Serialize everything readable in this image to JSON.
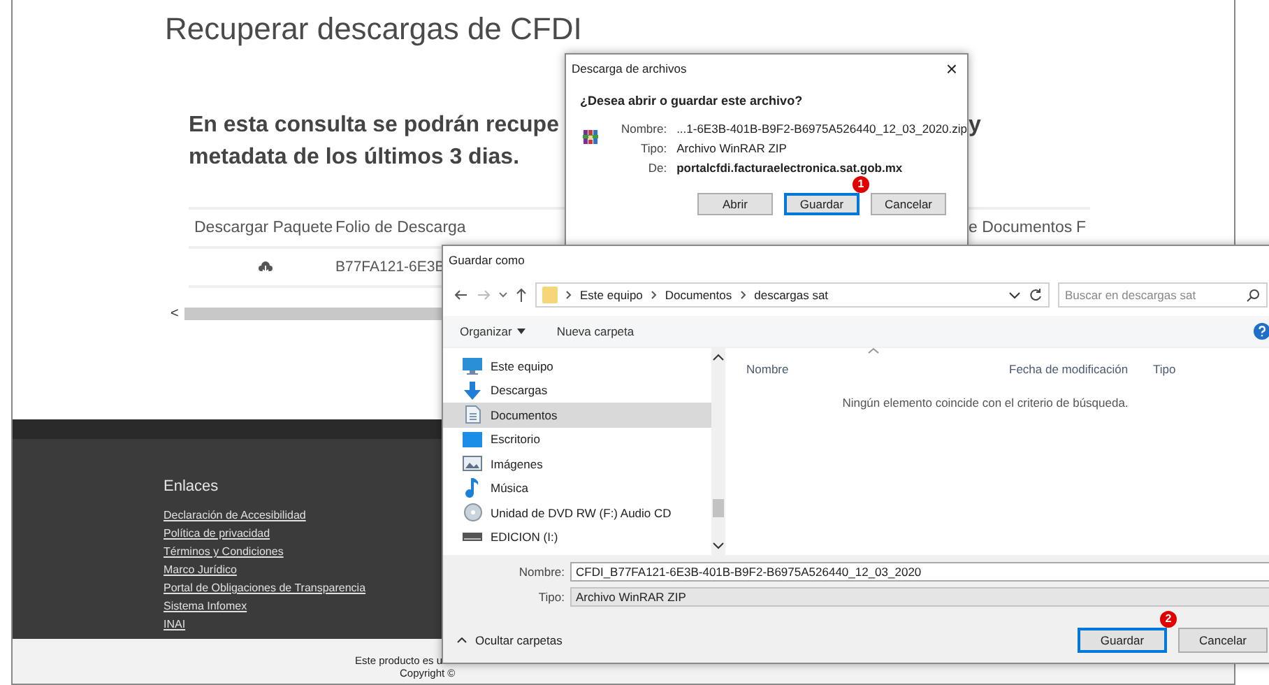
{
  "page": {
    "title": "Recuperar descargas de CFDI",
    "intro_lines": [
      "En esta consulta se podrán recupe",
      "metadata de los últimos 3 dias."
    ],
    "intro_tail": "y",
    "table": {
      "columns": [
        "Descargar Paquete",
        "Folio de Descarga",
        "e Documentos",
        "F"
      ],
      "rows": [
        {
          "folio": "B77FA121-6E3B"
        }
      ],
      "scroll_left": "<"
    },
    "footer": {
      "heading": "Enlaces",
      "links": [
        "Declaración de Accesibilidad",
        "Política de privacidad",
        "Términos y Condiciones",
        "Marco Jurídico",
        "Portal de Obligaciones de Transparencia",
        "Sistema Infomex",
        "INAI"
      ]
    },
    "bottom_lines": [
      "Este producto es u",
      "Copyright ©"
    ]
  },
  "download_dialog": {
    "title": "Descarga de archivos",
    "close": "×",
    "question": "¿Desea abrir o guardar este archivo?",
    "fields": [
      {
        "label": "Nombre:",
        "value": "...1-6E3B-401B-B9F2-B6975A526440_12_03_2020.zip",
        "bold": false
      },
      {
        "label": "Tipo:",
        "value": "Archivo WinRAR ZIP",
        "bold": false
      },
      {
        "label": "De:",
        "value": "portalcfdi.facturaelectronica.sat.gob.mx",
        "bold": true
      }
    ],
    "buttons": [
      {
        "label": "Abrir",
        "focused": false
      },
      {
        "label": "Guardar",
        "focused": true,
        "badge": "1"
      },
      {
        "label": "Cancelar",
        "focused": false
      }
    ]
  },
  "save_dialog": {
    "title": "Guardar como",
    "path": [
      "Este equipo",
      "Documentos",
      "descargas sat"
    ],
    "search": {
      "placeholder": "Buscar en descargas sat"
    },
    "toolbar": [
      {
        "label": "Organizar",
        "dropdown": true
      },
      {
        "label": "Nueva carpeta",
        "dropdown": false
      }
    ],
    "tree": [
      {
        "label": "Este equipo",
        "kind": "computer",
        "selected": false
      },
      {
        "label": "Descargas",
        "kind": "download",
        "selected": false
      },
      {
        "label": "Documentos",
        "kind": "document",
        "selected": true
      },
      {
        "label": "Escritorio",
        "kind": "desktop",
        "selected": false
      },
      {
        "label": "Imágenes",
        "kind": "pictures",
        "selected": false
      },
      {
        "label": "Música",
        "kind": "music",
        "selected": false
      },
      {
        "label": "Unidad de DVD RW (F:) Audio CD",
        "kind": "dvd",
        "selected": false
      },
      {
        "label": "EDICION (I:)",
        "kind": "drive",
        "selected": false
      }
    ],
    "columns": [
      "Nombre",
      "Fecha de modificación",
      "Tipo"
    ],
    "empty_message": "Ningún elemento coincide con el criterio de búsqueda.",
    "filename": {
      "label": "Nombre:",
      "value": "CFDI_B77FA121-6E3B-401B-B9F2-B6975A526440_12_03_2020"
    },
    "filetype": {
      "label": "Tipo:",
      "value": "Archivo WinRAR ZIP"
    },
    "hide_folders": "Ocultar carpetas",
    "buttons": [
      {
        "label": "Guardar",
        "focused": true,
        "badge": "2"
      },
      {
        "label": "Cancelar",
        "focused": false
      }
    ]
  }
}
